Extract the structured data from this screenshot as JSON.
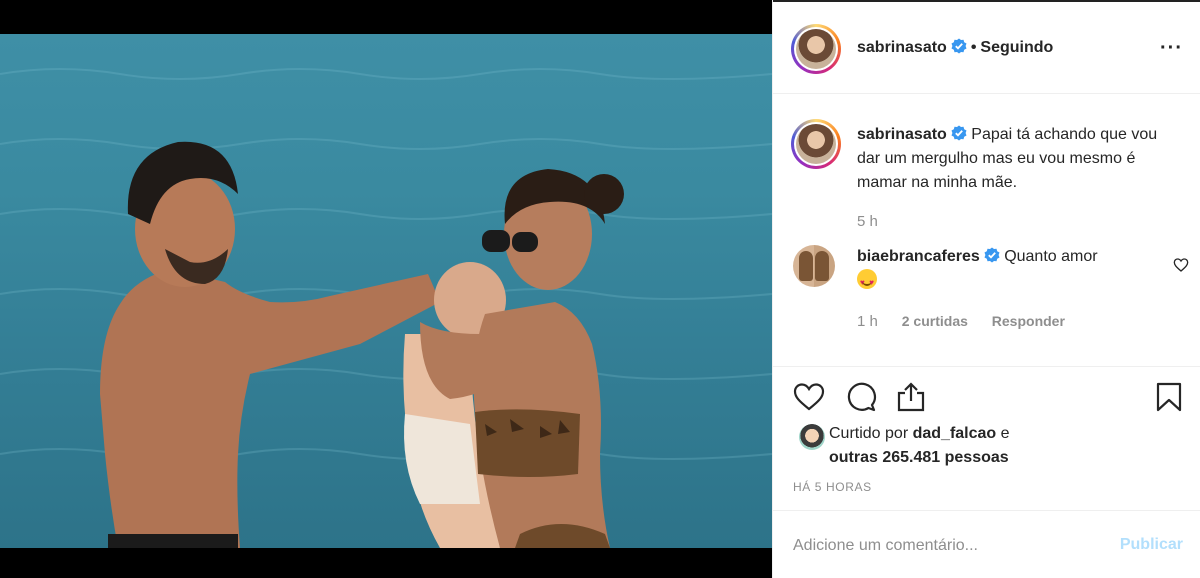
{
  "post": {
    "author": "sabrinasato",
    "follow_separator": "•",
    "follow_status": "Seguindo",
    "more_label": "···",
    "caption_text": "Papai tá achando que vou dar um mergulho mas eu vou mesmo é mamar na minha mãe.",
    "caption_time": "5 h"
  },
  "comments": [
    {
      "author": "biaebrancaferes",
      "text": "Quanto amor",
      "time": "1 h",
      "likes": "2 curtidas",
      "reply_label": "Responder"
    }
  ],
  "likes": {
    "prefix": "Curtido por",
    "user": "dad_falcao",
    "connector": "e",
    "others": "outras 265.481 pessoas"
  },
  "posted_ago": "HÁ 5 HORAS",
  "add_comment": {
    "placeholder": "Adicione um comentário...",
    "publish_label": "Publicar"
  },
  "icons": {
    "like": "heart-icon",
    "comment": "comment-bubble-icon",
    "share": "share-icon",
    "save": "bookmark-icon",
    "verified": "verified-badge-icon",
    "more": "more-options-icon"
  },
  "colors": {
    "verified": "#3897f0",
    "publish_disabled": "#b2dffc",
    "muted_text": "#8e8e8e",
    "sea": "#3a8aa0"
  }
}
